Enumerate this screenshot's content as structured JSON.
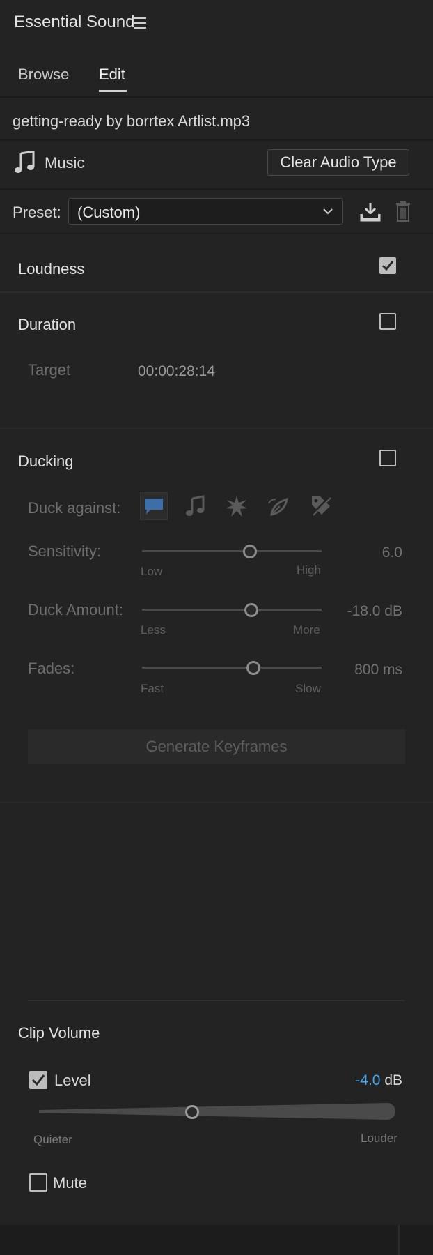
{
  "panel": {
    "title": "Essential Sound"
  },
  "tabs": [
    {
      "label": "Browse",
      "active": false
    },
    {
      "label": "Edit",
      "active": true
    }
  ],
  "clip": {
    "filename": "getting-ready by borrtex Artlist.mp3"
  },
  "audio_type": {
    "label": "Music",
    "icon": "music-note-icon",
    "clear_button": "Clear Audio Type"
  },
  "preset": {
    "label": "Preset:",
    "value": "(Custom)"
  },
  "loudness": {
    "title": "Loudness",
    "checked": true
  },
  "duration": {
    "title": "Duration",
    "checked": false,
    "target_label": "Target",
    "target_value": "00:00:28:14"
  },
  "ducking": {
    "title": "Ducking",
    "checked": false,
    "duck_against_label": "Duck against:",
    "duck_against_icons": [
      "dialogue-icon",
      "music-icon",
      "sfx-icon",
      "ambience-icon",
      "untagged-icon"
    ],
    "sensitivity": {
      "label": "Sensitivity:",
      "min_label": "Low",
      "max_label": "High",
      "value": "6.0",
      "fraction": 0.6
    },
    "duck_amount": {
      "label": "Duck Amount:",
      "min_label": "Less",
      "max_label": "More",
      "value": "-18.0 dB",
      "fraction": 0.61
    },
    "fades": {
      "label": "Fades:",
      "min_label": "Fast",
      "max_label": "Slow",
      "value": "800 ms",
      "fraction": 0.62
    },
    "generate_button": "Generate Keyframes"
  },
  "clip_volume": {
    "title": "Clip Volume",
    "level_label": "Level",
    "level_checked": true,
    "level_value": "-4.0",
    "level_unit": "dB",
    "level_fraction": 0.43,
    "min_label": "Quieter",
    "max_label": "Louder",
    "mute_label": "Mute",
    "mute_checked": false
  },
  "colors": {
    "background": "#232323",
    "accent": "#4aa6ea",
    "dialogue_icon": "#3e6ea8"
  }
}
